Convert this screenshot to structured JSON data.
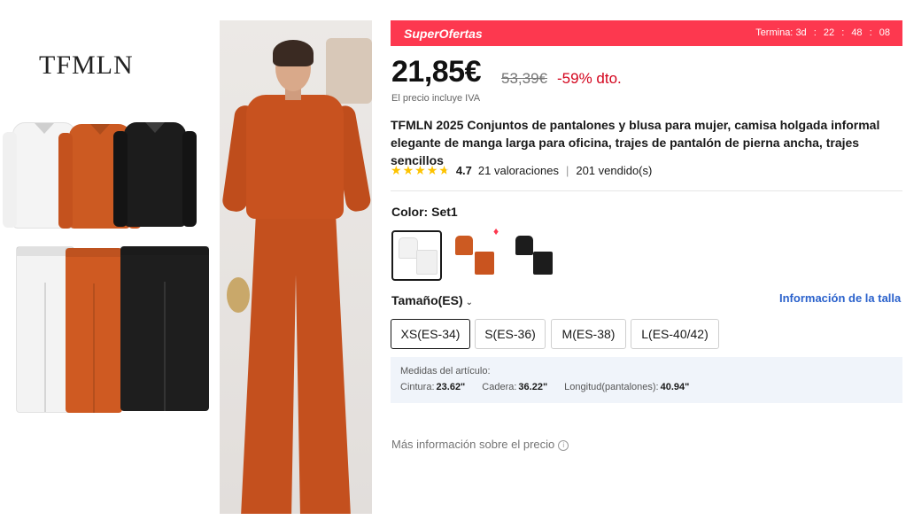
{
  "gallery": {
    "brand_logo": "TFMLN"
  },
  "promo": {
    "title": "SuperOfertas",
    "countdown_label": "Termina:",
    "countdown_days": "3d",
    "countdown_hours": "22",
    "countdown_minutes": "48",
    "countdown_seconds": "08",
    "banner_color": "#fd384f"
  },
  "price": {
    "current": "21,85€",
    "original": "53,39€",
    "discount": "-59% dto.",
    "vat_note": "El precio incluye IVA",
    "discount_color": "#d3031c"
  },
  "product": {
    "title": "TFMLN 2025 Conjuntos de pantalones y blusa para mujer, camisa holgada informal elegante de manga larga para oficina, trajes de pantalón de pierna ancha, trajes sencillos"
  },
  "rating": {
    "stars": 4.7,
    "value": "4.7",
    "count_text": "21 valoraciones",
    "divider": "|",
    "sold_text": "201 vendido(s)",
    "star_color": "#fdc300"
  },
  "color": {
    "label": "Color: Set1",
    "swatches": [
      {
        "name": "Set1",
        "selected": true
      },
      {
        "name": "Set2",
        "selected": false,
        "badge_icon": "fire-icon"
      },
      {
        "name": "Set3",
        "selected": false
      }
    ]
  },
  "size": {
    "label": "Tamaño(ES)",
    "guide_link": "Información de la talla",
    "options": [
      "XS(ES-34)",
      "S(ES-36)",
      "M(ES-38)",
      "L(ES-40/42)"
    ],
    "selected": "XS(ES-34)"
  },
  "measurements": {
    "title": "Medidas del artículo:",
    "items": [
      {
        "label": "Cintura:",
        "value": "23.62\""
      },
      {
        "label": "Cadera:",
        "value": "36.22\""
      },
      {
        "label": "Longitud(pantalones):",
        "value": "40.94\""
      }
    ]
  },
  "footer": {
    "price_info": "Más información sobre el precio",
    "info_icon": "info-icon"
  }
}
